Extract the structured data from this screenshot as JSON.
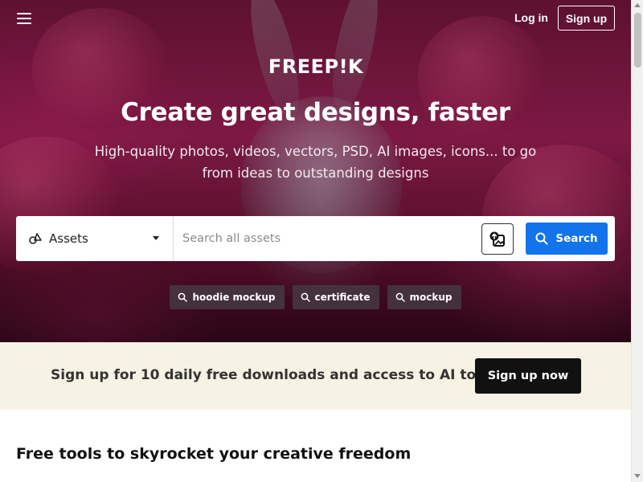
{
  "nav": {
    "menu_icon": "hamburger-menu-icon",
    "login_label": "Log in",
    "signup_label": "Sign up"
  },
  "brand": {
    "logo_text": "FREEP!K"
  },
  "hero": {
    "headline": "Create great designs, faster",
    "subheadline": "High-quality photos, videos, vectors, PSD, AI images, icons... to go from ideas to outstanding designs"
  },
  "search": {
    "asset_type_icon": "assets-icon",
    "asset_type_selected": "Assets",
    "placeholder": "Search all assets",
    "image_search_icon": "image-search-icon",
    "button_label": "Search",
    "button_icon": "search-icon",
    "button_color": "#1273eb"
  },
  "suggestions": [
    {
      "label": "hoodie mockup",
      "icon": "search-icon"
    },
    {
      "label": "certificate",
      "icon": "search-icon"
    },
    {
      "label": "mockup",
      "icon": "search-icon"
    }
  ],
  "promo": {
    "text": "Sign up for 10 daily free downloads and access to AI tools",
    "button_label": "Sign up now",
    "background": "#f6f2e4"
  },
  "section": {
    "title": "Free tools to skyrocket your creative freedom"
  }
}
